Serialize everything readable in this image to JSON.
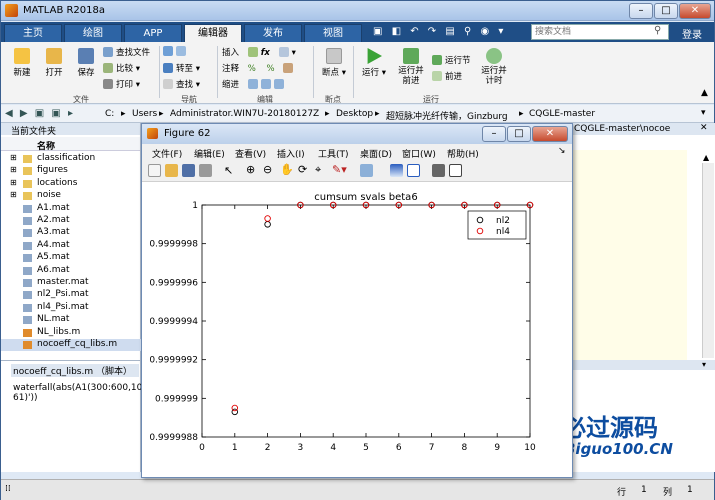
{
  "app": {
    "title": "MATLAB R2018a"
  },
  "tabs": [
    "主页",
    "绘图",
    "APP",
    "编辑器",
    "发布",
    "视图"
  ],
  "active_tab": "编辑器",
  "search": {
    "placeholder": "搜索文档"
  },
  "login_label": "登录",
  "ribbon": {
    "new": "新建",
    "open": "打开",
    "save": "保存",
    "find_files": "查找文件",
    "compare": "比较",
    "print": "打印",
    "goto": "转至",
    "find": "查找",
    "insert": "插入",
    "comment": "注释",
    "indent": "缩进",
    "breakpoints": "断点",
    "run": "运行",
    "run_advance": "运行并\n前进",
    "run_section": "运行节",
    "advance": "前进",
    "run_time": "运行并\n计时",
    "groups": [
      "文件",
      "导航",
      "编辑",
      "断点",
      "运行"
    ]
  },
  "address": [
    "C:",
    "Users",
    "Administrator.WIN7U-20180127Z",
    "Desktop",
    "超短脉冲光纤传输，Ginzburg",
    "CQGLE-master"
  ],
  "current_folder_label": "当前文件夹",
  "name_header": "名称",
  "files": [
    {
      "name": "classification",
      "type": "folder"
    },
    {
      "name": "figures",
      "type": "folder"
    },
    {
      "name": "locations",
      "type": "folder"
    },
    {
      "name": "noise",
      "type": "folder"
    },
    {
      "name": "A1.mat",
      "type": "mat"
    },
    {
      "name": "A2.mat",
      "type": "mat"
    },
    {
      "name": "A3.mat",
      "type": "mat"
    },
    {
      "name": "A4.mat",
      "type": "mat"
    },
    {
      "name": "A5.mat",
      "type": "mat"
    },
    {
      "name": "A6.mat",
      "type": "mat"
    },
    {
      "name": "master.mat",
      "type": "mat"
    },
    {
      "name": "nl2_Psi.mat",
      "type": "mat"
    },
    {
      "name": "nl4_Psi.mat",
      "type": "mat"
    },
    {
      "name": "NL.mat",
      "type": "mat"
    },
    {
      "name": "NL_libs.m",
      "type": "m"
    },
    {
      "name": "nocoeff_cq_libs.m",
      "type": "m"
    }
  ],
  "detail": {
    "title": "nocoeff_cq_libs.m （脚本）",
    "code": "waterfall(abs(A1(300:600,100\n61)'))"
  },
  "editor_path": "CQGLE-master\\nocoe",
  "status": {
    "row_label": "行",
    "row": "1",
    "col_label": "列",
    "col": "1"
  },
  "watermark": {
    "brand": "必过源码",
    "url": "Biguo100.CN"
  },
  "figure": {
    "title": "Figure 62",
    "menu": [
      "文件(F)",
      "编辑(E)",
      "查看(V)",
      "插入(I)",
      "工具(T)",
      "桌面(D)",
      "窗口(W)",
      "帮助(H)"
    ]
  },
  "chart_data": {
    "type": "scatter",
    "title": "cumsum svals beta6",
    "xlim": [
      0,
      10
    ],
    "ylim": [
      0.9999988,
      1
    ],
    "xticks": [
      "0",
      "1",
      "2",
      "3",
      "4",
      "5",
      "6",
      "7",
      "8",
      "9",
      "10"
    ],
    "yticks": [
      "0.9999988",
      "0.999999",
      "0.9999992",
      "0.9999994",
      "0.9999996",
      "0.9999998",
      "1"
    ],
    "legend_position": "top-right",
    "series": [
      {
        "name": "nl2",
        "color": "#000000",
        "x": [
          1,
          2,
          3,
          4,
          5,
          6,
          7,
          8,
          9,
          10
        ],
        "y": [
          0.99999893,
          0.9999999,
          1,
          1,
          1,
          1,
          1,
          1,
          1,
          1
        ]
      },
      {
        "name": "nl4",
        "color": "#e00000",
        "x": [
          1,
          2,
          3,
          4,
          5,
          6,
          7,
          8,
          9,
          10
        ],
        "y": [
          0.99999895,
          0.99999993,
          1,
          1,
          1,
          1,
          1,
          1,
          1,
          1
        ]
      }
    ]
  }
}
